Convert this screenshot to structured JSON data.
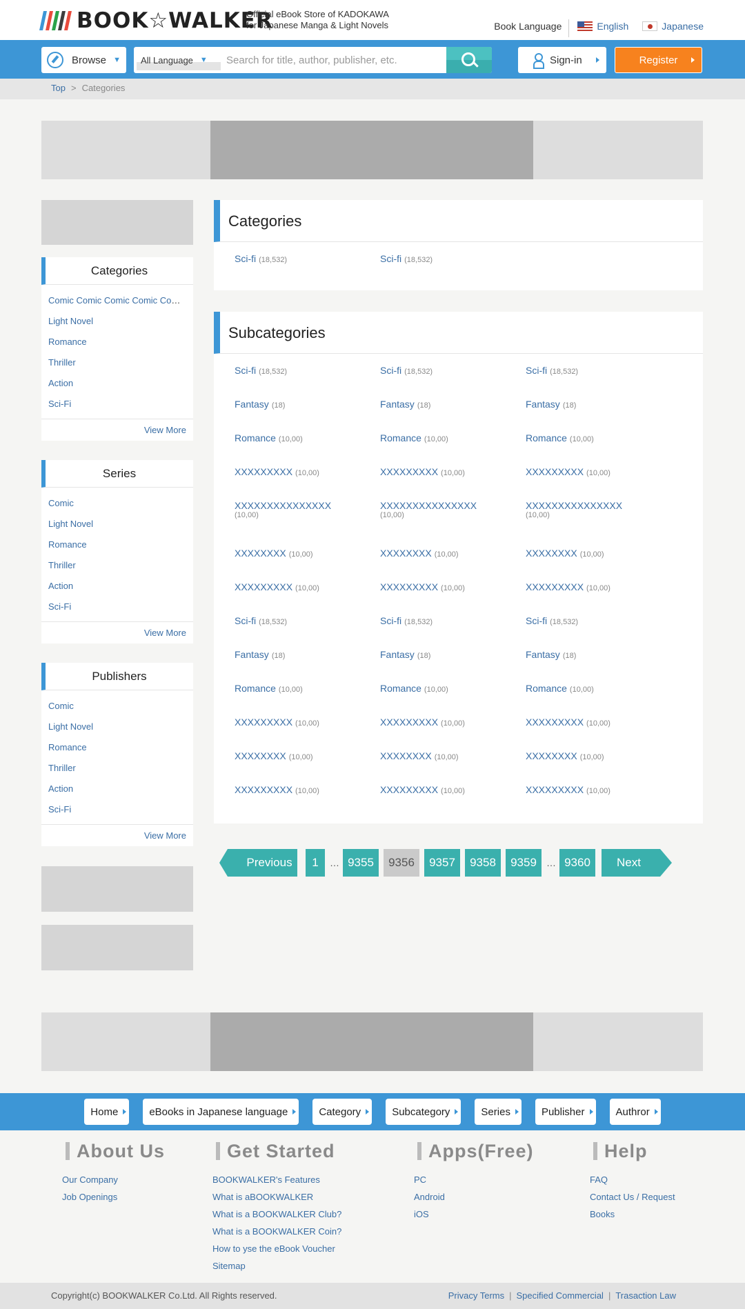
{
  "header": {
    "logo_text": "BOOK☆WALKER",
    "logo_colors": [
      "#3d96d6",
      "#e94b3c",
      "#2aa34a",
      "#3d3d3d",
      "#e94b3c"
    ],
    "tagline_line1": "Official eBook Store of KADOKAWA",
    "tagline_line2": "for Japanese Manga & Light Novels",
    "book_language_label": "Book Language",
    "lang_english": "English",
    "lang_japanese": "Japanese"
  },
  "nav": {
    "browse_label": "Browse",
    "language_select": "All Language",
    "search_placeholder": "Search for title, author, publisher, etc.",
    "signin_label": "Sign-in",
    "register_label": "Register"
  },
  "breadcrumb": {
    "top": "Top",
    "sep": ">",
    "current": "Categories"
  },
  "sidebar": {
    "categories": {
      "title": "Categories",
      "items": [
        "Comic Comic Comic Comic Comic Comic",
        "Light Novel",
        "Romance",
        "Thriller",
        "Action",
        "Sci-Fi"
      ],
      "more": "View More"
    },
    "series": {
      "title": "Series",
      "items": [
        "Comic",
        "Light Novel",
        "Romance",
        "Thriller",
        "Action",
        "Sci-Fi"
      ],
      "more": "View More"
    },
    "publishers": {
      "title": "Publishers",
      "items": [
        "Comic",
        "Light Novel",
        "Romance",
        "Thriller",
        "Action",
        "Sci-Fi"
      ],
      "more": "View More"
    }
  },
  "categories_panel": {
    "title": "Categories",
    "items": [
      {
        "name": "Sci-fi",
        "count": "(18,532)"
      },
      {
        "name": "Sci-fi",
        "count": "(18,532)"
      }
    ]
  },
  "subcategories_panel": {
    "title": "Subcategories",
    "items": [
      {
        "name": "Sci-fi",
        "count": "(18,532)"
      },
      {
        "name": "Sci-fi",
        "count": "(18,532)"
      },
      {
        "name": "Sci-fi",
        "count": "(18,532)"
      },
      {
        "name": "Fantasy",
        "count": "(18)"
      },
      {
        "name": "Fantasy",
        "count": "(18)"
      },
      {
        "name": "Fantasy",
        "count": "(18)"
      },
      {
        "name": "Romance",
        "count": "(10,00)"
      },
      {
        "name": "Romance",
        "count": "(10,00)"
      },
      {
        "name": "Romance",
        "count": "(10,00)"
      },
      {
        "name": "XXXXXXXXX",
        "count": "(10,00)"
      },
      {
        "name": "XXXXXXXXX",
        "count": "(10,00)"
      },
      {
        "name": "XXXXXXXXX",
        "count": "(10,00)"
      },
      {
        "name": "XXXXXXXXXXXXXXX",
        "count": "(10,00)",
        "tall": true
      },
      {
        "name": "XXXXXXXXXXXXXXX",
        "count": "(10,00)",
        "tall": true
      },
      {
        "name": "XXXXXXXXXXXXXXX",
        "count": "(10,00)",
        "tall": true
      },
      {
        "name": "XXXXXXXX",
        "count": "(10,00)"
      },
      {
        "name": "XXXXXXXX",
        "count": "(10,00)"
      },
      {
        "name": "XXXXXXXX",
        "count": "(10,00)"
      },
      {
        "name": "XXXXXXXXX",
        "count": "(10,00)"
      },
      {
        "name": "XXXXXXXXX",
        "count": "(10,00)"
      },
      {
        "name": "XXXXXXXXX",
        "count": "(10,00)"
      },
      {
        "name": "Sci-fi",
        "count": "(18,532)"
      },
      {
        "name": "Sci-fi",
        "count": "(18,532)"
      },
      {
        "name": "Sci-fi",
        "count": "(18,532)"
      },
      {
        "name": "Fantasy",
        "count": "(18)"
      },
      {
        "name": "Fantasy",
        "count": "(18)"
      },
      {
        "name": "Fantasy",
        "count": "(18)"
      },
      {
        "name": "Romance",
        "count": "(10,00)"
      },
      {
        "name": "Romance",
        "count": "(10,00)"
      },
      {
        "name": "Romance",
        "count": "(10,00)"
      },
      {
        "name": "XXXXXXXXX",
        "count": "(10,00)"
      },
      {
        "name": "XXXXXXXXX",
        "count": "(10,00)"
      },
      {
        "name": "XXXXXXXXX",
        "count": "(10,00)"
      },
      {
        "name": "XXXXXXXX",
        "count": "(10,00)"
      },
      {
        "name": "XXXXXXXX",
        "count": "(10,00)"
      },
      {
        "name": "XXXXXXXX",
        "count": "(10,00)"
      },
      {
        "name": "XXXXXXXXX",
        "count": "(10,00)"
      },
      {
        "name": "XXXXXXXXX",
        "count": "(10,00)"
      },
      {
        "name": "XXXXXXXXX",
        "count": "(10,00)"
      }
    ]
  },
  "pagination": {
    "previous": "Previous",
    "next": "Next",
    "ellipsis": "…",
    "pages": [
      {
        "label": "1",
        "current": false
      },
      {
        "label": "…",
        "ellipsis": true
      },
      {
        "label": "9355",
        "current": false
      },
      {
        "label": "9356",
        "current": true
      },
      {
        "label": "9357",
        "current": false
      },
      {
        "label": "9358",
        "current": false
      },
      {
        "label": "9359",
        "current": false
      },
      {
        "label": "…",
        "ellipsis": true
      },
      {
        "label": "9360",
        "current": false
      }
    ]
  },
  "footer_nav": [
    "Home",
    "eBooks in Japanese language",
    "Category",
    "Subcategory",
    "Series",
    "Publisher",
    "Authror"
  ],
  "footer": {
    "about": {
      "title": "About Us",
      "links": [
        "Our Company",
        "Job Openings"
      ]
    },
    "get_started": {
      "title": "Get Started",
      "links": [
        "BOOKWALKER's Features",
        "What is aBOOKWALKER",
        "What is a BOOKWALKER Club?",
        "What is a BOOKWALKER Coin?",
        "How to yse the eBook Voucher",
        "Sitemap"
      ]
    },
    "apps": {
      "title": "Apps(Free)",
      "links": [
        "PC",
        "Android",
        "iOS"
      ]
    },
    "help": {
      "title": "Help",
      "links": [
        "FAQ",
        "Contact Us / Request",
        "Books"
      ]
    },
    "copyright": "Copyright(c) BOOKWALKER Co.Ltd. All Rights reserved.",
    "legal": [
      "Privacy Terms",
      "Specified Commercial",
      "Trasaction Law"
    ]
  },
  "colors": {
    "accent": "#3d96d6",
    "register": "#f7821e",
    "pager": "#3ab0ad",
    "link": "#3a6ea5"
  }
}
